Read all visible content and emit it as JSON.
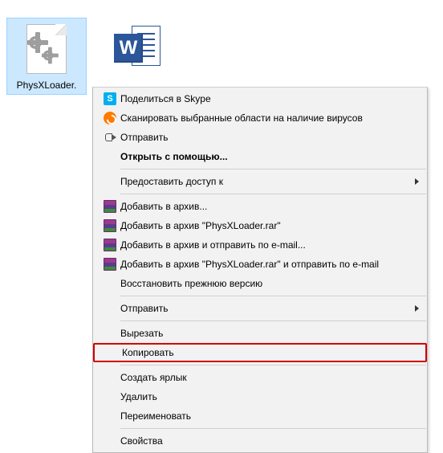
{
  "files": [
    {
      "label": "PhysXLoader."
    },
    {
      "label": ""
    }
  ],
  "menu": {
    "groups": [
      [
        {
          "id": "share-skype",
          "label": "Поделиться в Skype",
          "icon": "skype"
        },
        {
          "id": "scan-virus",
          "label": "Сканировать выбранные области на наличие вирусов",
          "icon": "avast"
        },
        {
          "id": "send",
          "label": "Отправить",
          "icon": "share"
        },
        {
          "id": "open-with",
          "label": "Открыть с помощью...",
          "bold": true
        }
      ],
      [
        {
          "id": "grant-access",
          "label": "Предоставить доступ к",
          "submenu": true
        }
      ],
      [
        {
          "id": "rar-add",
          "label": "Добавить в архив...",
          "icon": "rar"
        },
        {
          "id": "rar-add-name",
          "label": "Добавить в архив \"PhysXLoader.rar\"",
          "icon": "rar"
        },
        {
          "id": "rar-email",
          "label": "Добавить в архив и отправить по e-mail...",
          "icon": "rar"
        },
        {
          "id": "rar-name-email",
          "label": "Добавить в архив \"PhysXLoader.rar\" и отправить по e-mail",
          "icon": "rar"
        },
        {
          "id": "restore-prev",
          "label": "Восстановить прежнюю версию"
        }
      ],
      [
        {
          "id": "send-to",
          "label": "Отправить",
          "submenu": true
        }
      ],
      [
        {
          "id": "cut",
          "label": "Вырезать"
        },
        {
          "id": "copy",
          "label": "Копировать",
          "highlight": true
        }
      ],
      [
        {
          "id": "shortcut",
          "label": "Создать ярлык"
        },
        {
          "id": "delete",
          "label": "Удалить"
        },
        {
          "id": "rename",
          "label": "Переименовать"
        }
      ],
      [
        {
          "id": "properties",
          "label": "Свойства"
        }
      ]
    ]
  }
}
